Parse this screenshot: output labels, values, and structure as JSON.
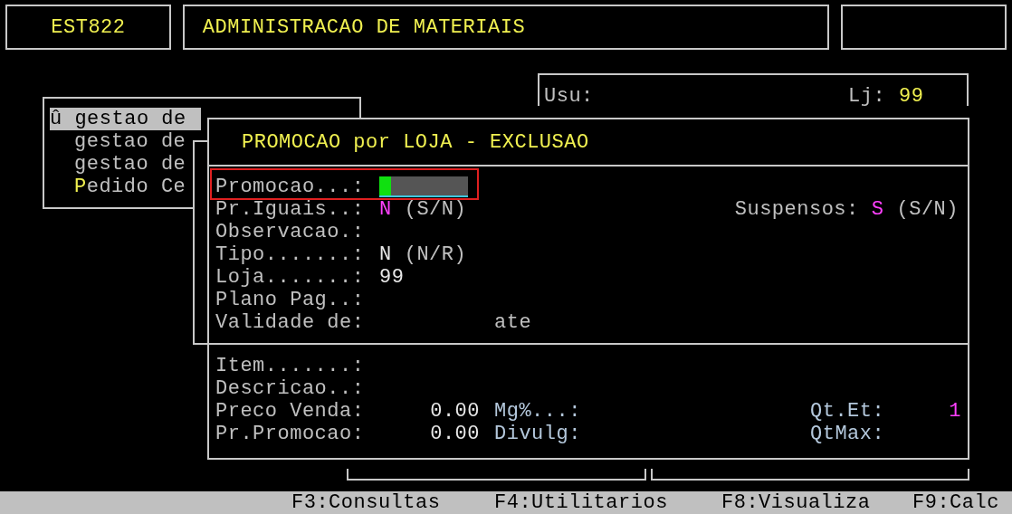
{
  "header": {
    "program_code": "EST822",
    "system_title": "ADMINISTRACAO DE MATERIAIS"
  },
  "user_panel": {
    "user_label": "Usu:",
    "store_label": "Lj:",
    "store_value": "99"
  },
  "menu": {
    "items": [
      {
        "marker": "û",
        "label": "gestao de",
        "selected": true,
        "hotkey": false
      },
      {
        "label": "gestao de",
        "selected": false,
        "hotkey": false
      },
      {
        "label": "gestao de",
        "selected": false,
        "hotkey": false
      },
      {
        "label": "Pedido Ce",
        "selected": false,
        "hotkey": true
      }
    ]
  },
  "dialog": {
    "title": "PROMOCAO por LOJA - EXCLUSAO",
    "fields": [
      {
        "kind": "input",
        "label": "Promocao...:"
      },
      {
        "kind": "flag",
        "label": "Pr.Iguais..:",
        "value": "N",
        "hint": "(S/N)",
        "extra": {
          "label": "Suspensos:",
          "value": "S",
          "hint": "(S/N)"
        }
      },
      {
        "kind": "text",
        "label": "Observacao.:"
      },
      {
        "kind": "text",
        "label": "Tipo.......:",
        "value": "N",
        "hint": "(N/R)"
      },
      {
        "kind": "text",
        "label": "Loja.......:",
        "value": "99"
      },
      {
        "kind": "text",
        "label": "Plano Pag..:"
      },
      {
        "kind": "range",
        "label": "Validade de:",
        "to_label": "ate"
      }
    ],
    "items": [
      {
        "label": "Item.......:"
      },
      {
        "label": "Descricao..:"
      },
      {
        "label": "Preco Venda:",
        "value": "0.00",
        "mid_label": "Mg%...:",
        "right_label": "Qt.Et:",
        "right_value": "1"
      },
      {
        "label": "Pr.Promocao:",
        "value": "0.00",
        "mid_label": "Divulg:",
        "right_label": "QtMax:"
      }
    ]
  },
  "function_keys": [
    "F3:Consultas",
    "F4:Utilitarios",
    "F8:Visualiza",
    "F9:Calc"
  ]
}
